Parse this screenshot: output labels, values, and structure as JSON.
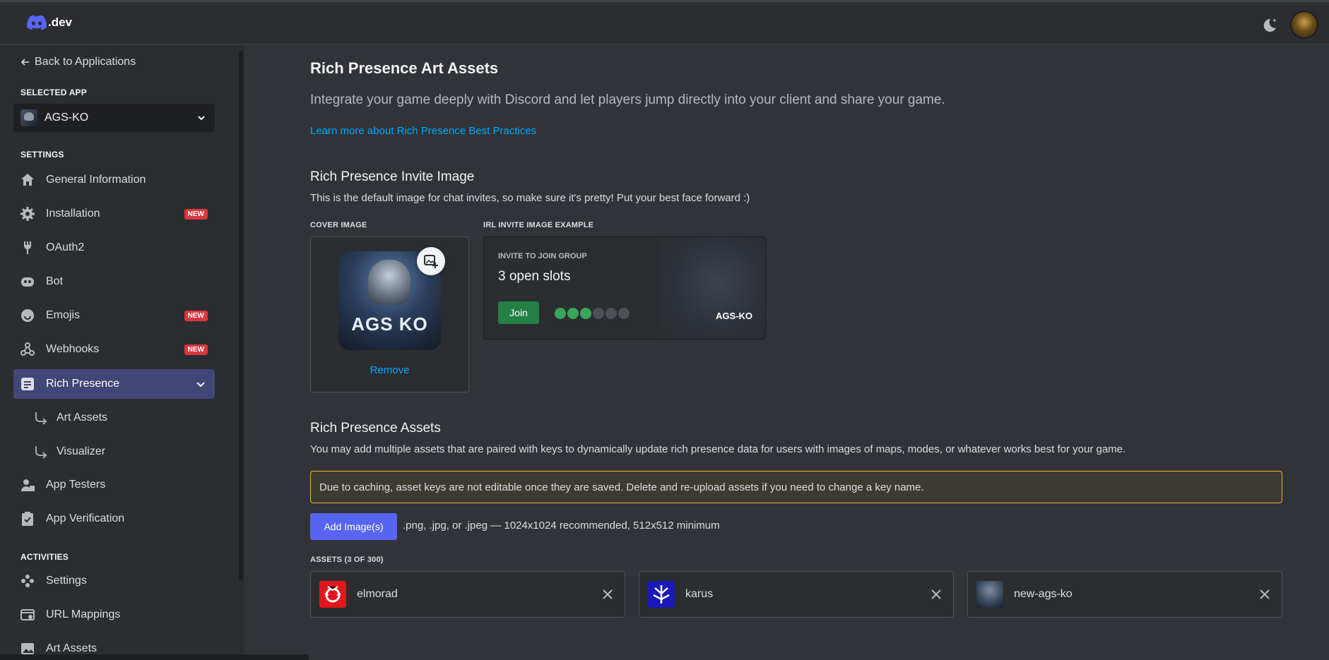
{
  "header": {
    "logo_text": ".dev",
    "theme_icon": "moon-star-icon",
    "avatar_icon": "avatar"
  },
  "sidebar": {
    "back_label": "Back to Applications",
    "selected_app_heading": "SELECTED APP",
    "selected_app": "AGS-KO",
    "settings_heading": "SETTINGS",
    "items": [
      {
        "label": "General Information",
        "icon": "home-icon",
        "badge": ""
      },
      {
        "label": "Installation",
        "icon": "gear-icon",
        "badge": "NEW"
      },
      {
        "label": "OAuth2",
        "icon": "wrench-icon",
        "badge": ""
      },
      {
        "label": "Bot",
        "icon": "bot-icon",
        "badge": ""
      },
      {
        "label": "Emojis",
        "icon": "smile-icon",
        "badge": "NEW"
      },
      {
        "label": "Webhooks",
        "icon": "webhook-icon",
        "badge": "NEW"
      },
      {
        "label": "Rich Presence",
        "icon": "list-icon",
        "badge": ""
      }
    ],
    "subitems": [
      {
        "label": "Art Assets"
      },
      {
        "label": "Visualizer"
      }
    ],
    "items2": [
      {
        "label": "App Testers",
        "icon": "testers-icon"
      },
      {
        "label": "App Verification",
        "icon": "clipboard-check-icon"
      }
    ],
    "activities_heading": "ACTIVITIES",
    "activities": [
      {
        "label": "Settings",
        "icon": "controller-icon"
      },
      {
        "label": "URL Mappings",
        "icon": "url-icon"
      },
      {
        "label": "Art Assets",
        "icon": "image-icon"
      }
    ]
  },
  "main": {
    "title": "Rich Presence Art Assets",
    "intro": "Integrate your game deeply with Discord and let players jump directly into your client and share your game.",
    "learn_link": "Learn more about Rich Presence Best Practices",
    "invite_section": {
      "title": "Rich Presence Invite Image",
      "desc": "This is the default image for chat invites, so make sure it's pretty! Put your best face forward :)",
      "cover_label": "COVER IMAGE",
      "example_label": "IRL INVITE IMAGE EXAMPLE",
      "cover_text": "AGS KO",
      "remove_label": "Remove",
      "invite_title": "INVITE TO JOIN GROUP",
      "slots_text": "3 open slots",
      "join_label": "Join",
      "app_name": "AGS-KO"
    },
    "assets_section": {
      "title": "Rich Presence Assets",
      "desc": "You may add multiple assets that are paired with keys to dynamically update rich presence data for users with images of maps, modes, or whatever works best for your game.",
      "warning": "Due to caching, asset keys are not editable once they are saved. Delete and re-upload assets if you need to change a key name.",
      "add_label": "Add Image(s)",
      "hint": ".png, .jpg, or .jpeg — 1024x1024 recommended, 512x512 minimum",
      "count_label": "ASSETS (3 OF 300)",
      "assets": [
        {
          "name": "elmorad",
          "color": "#e3161d"
        },
        {
          "name": "karus",
          "color": "#1a1ab8"
        },
        {
          "name": "new-ags-ko",
          "color": "#3a4a5e"
        }
      ]
    }
  }
}
